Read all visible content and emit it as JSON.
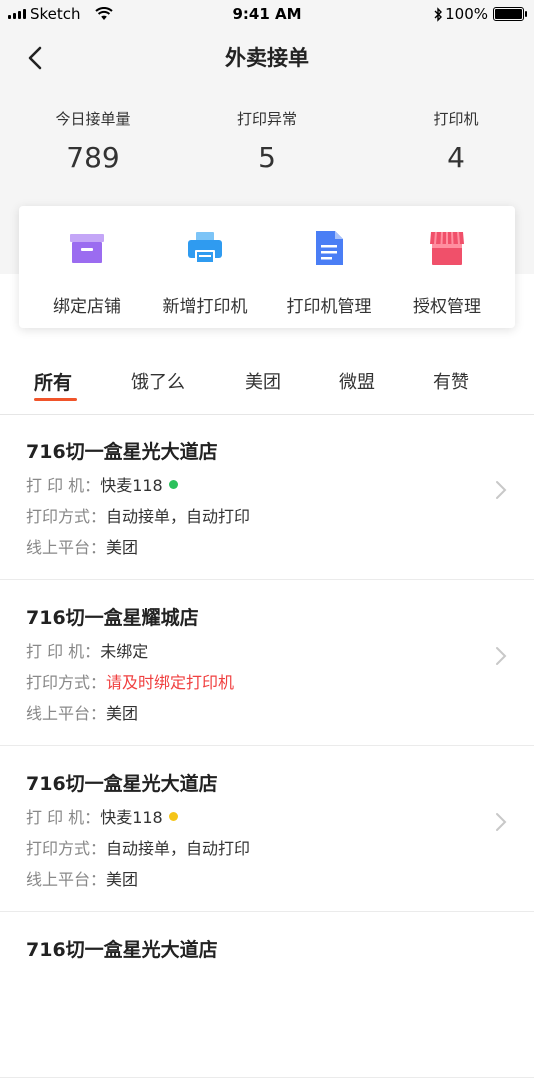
{
  "statusbar": {
    "carrier": "Sketch",
    "time": "9:41 AM",
    "battery": "100%"
  },
  "header": {
    "title": "外卖接单"
  },
  "stats": [
    {
      "label": "今日接单量",
      "value": "789"
    },
    {
      "label": "打印异常",
      "value": "5"
    },
    {
      "label": "打印机",
      "value": "4"
    }
  ],
  "actions": [
    {
      "label": "绑定店铺",
      "icon": "archive-box-icon",
      "color": "#9b6cf0"
    },
    {
      "label": "新增打印机",
      "icon": "printer-icon",
      "color": "#2f9bf0"
    },
    {
      "label": "打印机管理",
      "icon": "document-icon",
      "color": "#4a7ef5"
    },
    {
      "label": "授权管理",
      "icon": "storefront-icon",
      "color": "#f0506a"
    }
  ],
  "tabs": [
    {
      "label": "所有",
      "active": true
    },
    {
      "label": "饿了么",
      "active": false
    },
    {
      "label": "美团",
      "active": false
    },
    {
      "label": "微盟",
      "active": false
    },
    {
      "label": "有赞",
      "active": false
    }
  ],
  "field_labels": {
    "printer": "打 印 机：",
    "mode": "打印方式：",
    "platform": "线上平台："
  },
  "stores": [
    {
      "name": "716切一盒星光大道店",
      "printer": "快麦118",
      "status_color": "#2bc15c",
      "mode": "自动接单，自动打印",
      "platform": "美团"
    },
    {
      "name": "716切一盒星耀城店",
      "printer": "未绑定",
      "status_color": "",
      "mode": "请及时绑定打印机",
      "platform": "美团"
    },
    {
      "name": "716切一盒星光大道店",
      "printer": "快麦118",
      "status_color": "#f5c518",
      "mode": "自动接单，自动打印",
      "platform": "美团"
    },
    {
      "name": "716切一盒星光大道店"
    }
  ],
  "colors": {
    "accent": "#f0542a",
    "warning_text": "#f04040"
  }
}
